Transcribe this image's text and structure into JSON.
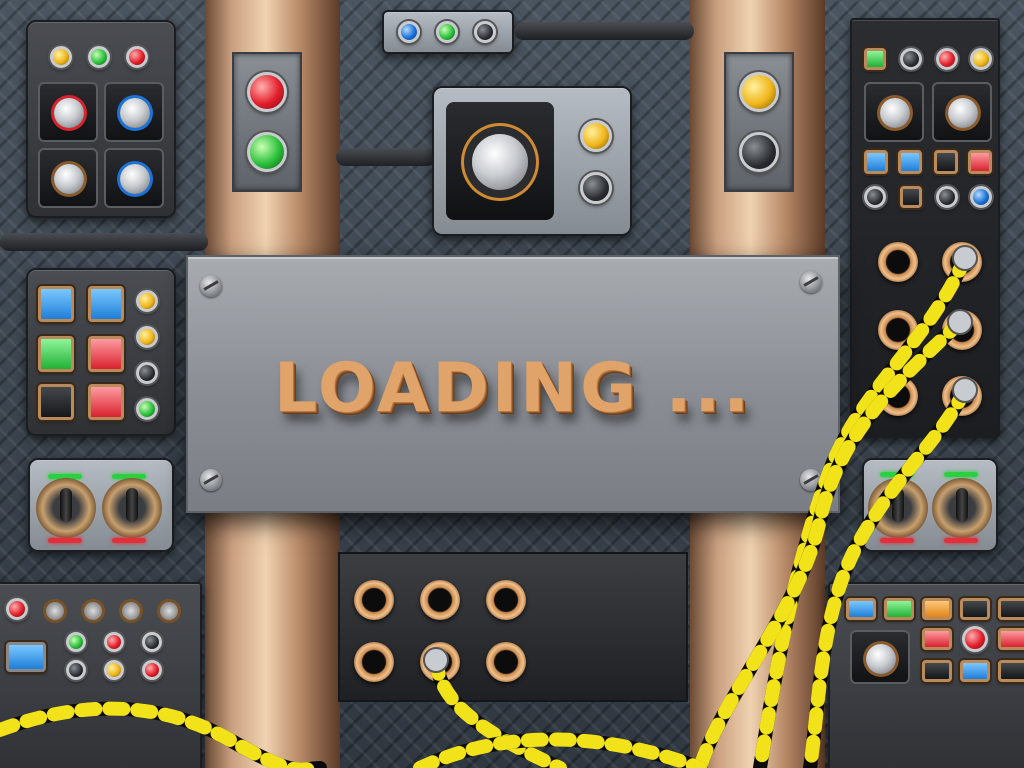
{
  "screen": {
    "loading_label": "LOADING ..."
  },
  "colors": {
    "text_copper": "#e0a36a",
    "cable_yellow": "#f2e21a",
    "cable_black": "#0a0a0a",
    "plate_metal": "#8c9096"
  },
  "icons": {
    "screw": "screw-icon",
    "joystick": "joystick-icon",
    "knob": "rotary-knob-icon",
    "socket": "jack-socket-icon",
    "indicator": "indicator-lamp-icon"
  }
}
